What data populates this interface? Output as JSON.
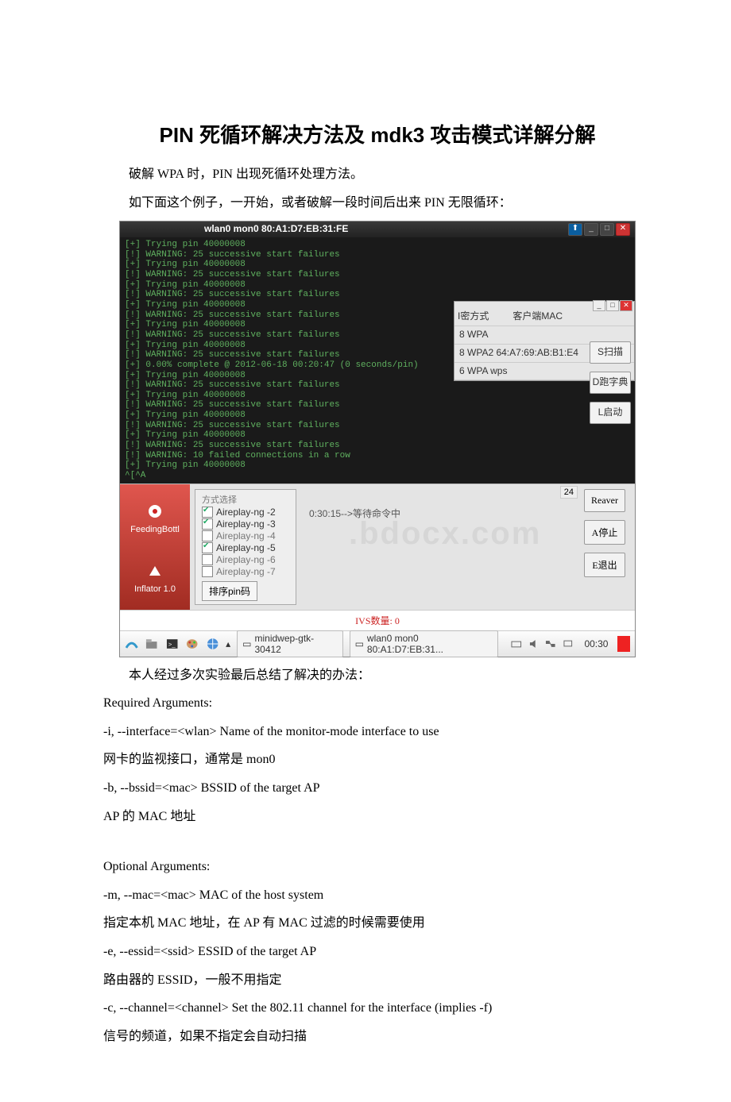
{
  "doc": {
    "title": "PIN 死循环解决方法及 mdk3 攻击模式详解分解",
    "p1": "破解 WPA 时，PIN 出现死循环处理方法。",
    "p2": "如下面这个例子，一开始，或者破解一段时间后出来 PIN 无限循环：",
    "p3": "本人经过多次实验最后总结了解决的办法：",
    "req_title": "Required Arguments:",
    "req_1": "-i, --interface=<wlan> Name of the monitor-mode interface to use",
    "req_2": "网卡的监视接口，通常是 mon0",
    "req_3": "-b, --bssid=<mac> BSSID of the target AP",
    "req_4": "AP 的 MAC 地址",
    "opt_title": "Optional Arguments:",
    "opt_1": "-m, --mac=<mac> MAC of the host system",
    "opt_2": "指定本机 MAC 地址，在 AP 有 MAC 过滤的时候需要使用",
    "opt_3": "-e, --essid=<ssid> ESSID of the target AP",
    "opt_4": "路由器的 ESSID，一般不用指定",
    "opt_5": "-c, --channel=<channel> Set the 802.11 channel for the interface (implies -f)",
    "opt_6": "信号的频道，如果不指定会自动扫描"
  },
  "terminal": {
    "title": "wlan0 mon0 80:A1:D7:EB:31:FE",
    "lines": [
      "[+] Trying pin 40000008",
      "[!] WARNING: 25 successive start failures",
      "[+] Trying pin 40000008",
      "[!] WARNING: 25 successive start failures",
      "[+] Trying pin 40000008",
      "[!] WARNING: 25 successive start failures",
      "[+] Trying pin 40000008",
      "[!] WARNING: 25 successive start failures",
      "[+] Trying pin 40000008",
      "[!] WARNING: 25 successive start failures",
      "[+] Trying pin 40000008",
      "[!] WARNING: 25 successive start failures",
      "[+] 0.00% complete @ 2012-06-18 00:20:47 (0 seconds/pin)",
      "[+] Trying pin 40000008",
      "[!] WARNING: 25 successive start failures",
      "[+] Trying pin 40000008",
      "[!] WARNING: 25 successive start failures",
      "[+] Trying pin 40000008",
      "[!] WARNING: 25 successive start failures",
      "[+] Trying pin 40000008",
      "[!] WARNING: 25 successive start failures",
      "[!] WARNING: 10 failed connections in a row",
      "[+] Trying pin 40000008",
      "^[^A"
    ]
  },
  "panel": {
    "col1": "I密方式",
    "col2": "客户端MAC",
    "rows": [
      "8   WPA",
      "8   WPA2   64:A7:69:AB:B1:E4",
      "6   WPA   wps"
    ],
    "btns": [
      "S扫描",
      "D跑字典",
      "L启动"
    ]
  },
  "lower": {
    "sidebar1": "FeedingBottl",
    "sidebar2": "Inflator 1.0",
    "mode_title": "方式选择",
    "modes": [
      {
        "label": "Aireplay-ng -2",
        "on": true
      },
      {
        "label": "Aireplay-ng -3",
        "on": true
      },
      {
        "label": "Aireplay-ng -4",
        "on": false
      },
      {
        "label": "Aireplay-ng -5",
        "on": true
      },
      {
        "label": "Aireplay-ng -6",
        "on": false
      },
      {
        "label": "Aireplay-ng -7",
        "on": false
      }
    ],
    "sort_btn": "排序pin码",
    "timer": "0:30:15-->等待命令中",
    "watermark": ".bdocx.com",
    "count": "24",
    "right_btns": [
      "Reaver",
      "A停止",
      "E退出"
    ],
    "ivs": "IVS数量: 0"
  },
  "taskbar": {
    "app1": "minidwep-gtk-30412",
    "app2": "wlan0 mon0 80:A1:D7:EB:31...",
    "clock": "00:30"
  }
}
